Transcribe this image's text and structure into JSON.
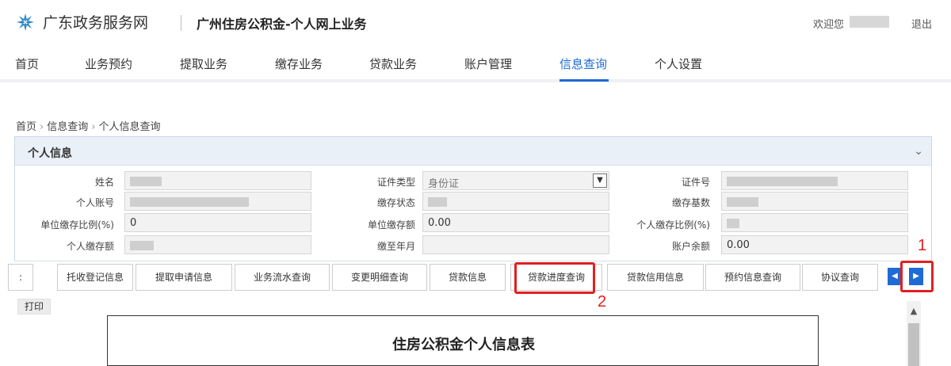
{
  "header": {
    "site_name": "广东政务服务网",
    "system_title": "广州住房公积金-个人网上业务",
    "welcome": "欢迎您",
    "logout": "退出"
  },
  "nav": [
    "首页",
    "业务预约",
    "提取业务",
    "缴存业务",
    "贷款业务",
    "账户管理",
    "信息查询",
    "个人设置"
  ],
  "nav_active": "信息查询",
  "breadcrumb": [
    "首页",
    "信息查询",
    "个人信息查询"
  ],
  "panel": {
    "title": "个人信息",
    "fields": {
      "name_label": "姓名",
      "id_type_label": "证件类型",
      "id_type_value": "身份证",
      "id_no_label": "证件号",
      "account_label": "个人账号",
      "deposit_status_label": "缴存状态",
      "deposit_base_label": "缴存基数",
      "unit_ratio_label": "单位缴存比例(%)",
      "unit_ratio_value": "0",
      "unit_amount_label": "单位缴存额",
      "unit_amount_value": "0.00",
      "personal_ratio_label": "个人缴存比例(%)",
      "personal_amount_label": "个人缴存额",
      "paid_to_label": "缴至年月",
      "balance_label": "账户余额",
      "balance_value": "0.00"
    }
  },
  "tabs": [
    "托收登记信息",
    "提取申请信息",
    "业务流水查询",
    "变更明细查询",
    "贷款信息",
    "贷款进度查询",
    "贷款信用信息",
    "预约信息查询",
    "协议查询"
  ],
  "annotations": {
    "one": "1",
    "two": "2"
  },
  "print_label": "打印",
  "doc_title": "住房公积金个人信息表",
  "colors": {
    "accent": "#1e6bd6",
    "highlight": "#e02020"
  },
  "icons": {
    "prev": "chevron-left-icon",
    "next": "chevron-right-icon",
    "collapse": "double-chevron-down-icon"
  }
}
